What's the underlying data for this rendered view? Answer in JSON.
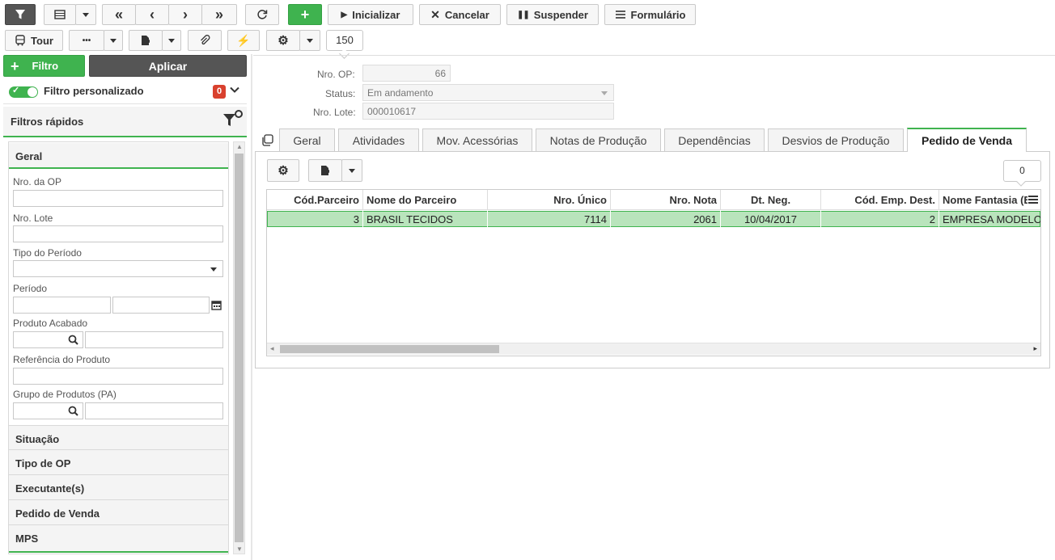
{
  "toolbar": {
    "inicializar": "Inicializar",
    "cancelar": "Cancelar",
    "suspender": "Suspender",
    "formulario": "Formulário",
    "tour": "Tour",
    "more": "•••",
    "page_size": "150"
  },
  "sidebar": {
    "filtro_label": "Filtro",
    "aplicar_label": "Aplicar",
    "filtro_personalizado": "Filtro personalizado",
    "filtro_count": "0",
    "filtros_rapidos": "Filtros rápidos",
    "geral": "Geral",
    "fields": {
      "nro_op": "Nro. da OP",
      "nro_lote": "Nro. Lote",
      "tipo_periodo": "Tipo do Período",
      "periodo": "Período",
      "produto_acabado": "Produto Acabado",
      "referencia_produto": "Referência do Produto",
      "grupo_produtos": "Grupo de Produtos (PA)"
    },
    "sections": [
      "Situação",
      "Tipo de OP",
      "Executante(s)",
      "Pedido de Venda",
      "MPS"
    ]
  },
  "header_form": {
    "nro_op_label": "Nro. OP:",
    "nro_op_value": "66",
    "status_label": "Status:",
    "status_value": "Em andamento",
    "nro_lote_label": "Nro. Lote:",
    "nro_lote_value": "000010617"
  },
  "tabs": [
    "Geral",
    "Atividades",
    "Mov. Acessórias",
    "Notas de Produção",
    "Dependências",
    "Desvios de Produção",
    "Pedido de Venda"
  ],
  "active_tab": "Pedido de Venda",
  "grid": {
    "count": "0",
    "columns": [
      "Cód.Parceiro",
      "Nome do Parceiro",
      "Nro. Único",
      "Nro. Nota",
      "Dt. Neg.",
      "Cód. Emp. Dest.",
      "Nome Fantasia (E"
    ],
    "rows": [
      [
        "3",
        "BRASIL TECIDOS",
        "7114",
        "2061",
        "10/04/2017",
        "2",
        "EMPRESA MODELO"
      ]
    ]
  },
  "colors": {
    "accent_green": "#3fb34f",
    "selected_row": "#b9e4bc",
    "dark_button": "#555555",
    "badge_red": "#d9412e"
  }
}
